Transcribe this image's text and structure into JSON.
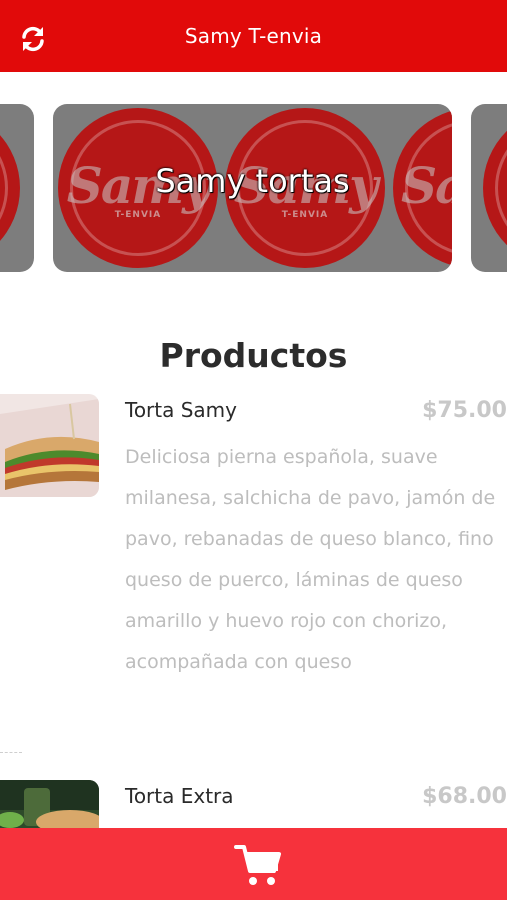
{
  "header": {
    "title": "Samy T-envia",
    "refresh_icon": "refresh-icon"
  },
  "carousel": {
    "caption": "Samy tortas",
    "logo_text": "Samy",
    "logo_sub": "T-ENVIA"
  },
  "products_title": "Productos",
  "products": [
    {
      "name": "Torta Samy",
      "price": "$75.00",
      "description": "Deliciosa pierna española, suave milanesa, salchicha de pavo, jamón de pavo, rebanadas de queso blanco, fino queso de puerco, láminas de queso amarillo y huevo rojo con chorizo, acompañada con queso"
    },
    {
      "name": "Torta Extra",
      "price": "$68.00"
    }
  ],
  "cart": {
    "icon": "cart-icon"
  },
  "colors": {
    "header": "#e10a0a",
    "cart_bar": "#f6323c",
    "price": "#c8c8c8"
  }
}
